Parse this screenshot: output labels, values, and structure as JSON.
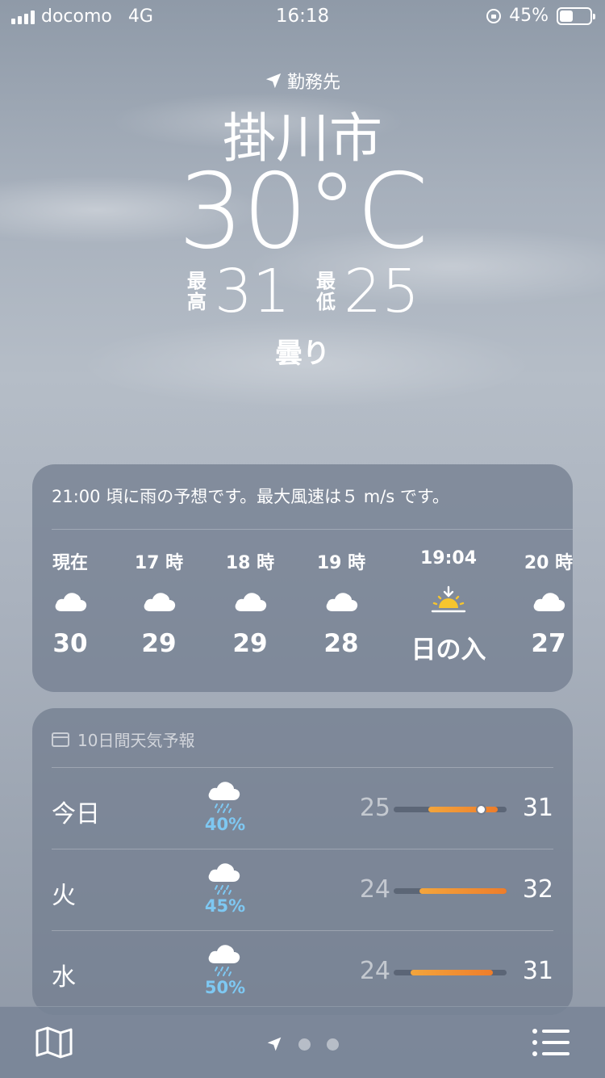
{
  "status_bar": {
    "carrier": "docomo",
    "network": "4G",
    "time": "16:18",
    "battery": "45%",
    "battery_level": 0.45
  },
  "header": {
    "location_label": "勤務先",
    "city": "掛川市",
    "temperature": "30°C",
    "high_label": "最高",
    "high": "31",
    "low_label": "最低",
    "low": "25",
    "condition": "曇り"
  },
  "hourly": {
    "summary": "21:00 頃に雨の予想です。最大風速は５ m/s です。",
    "items": [
      {
        "label": "現在",
        "icon": "cloud-icon",
        "value": "30"
      },
      {
        "label": "17 時",
        "icon": "cloud-icon",
        "value": "29"
      },
      {
        "label": "18 時",
        "icon": "cloud-icon",
        "value": "29"
      },
      {
        "label": "19 時",
        "icon": "cloud-icon",
        "value": "28"
      },
      {
        "label": "19:04",
        "icon": "sunset-icon",
        "value": "日の入"
      },
      {
        "label": "20 時",
        "icon": "cloud-icon",
        "value": "27"
      }
    ]
  },
  "daily": {
    "title": "10日間天気予報",
    "days": [
      {
        "day": "今日",
        "icon": "cloud-rain-icon",
        "pop": "40%",
        "low": "25",
        "high": "31",
        "range_start": 0.31,
        "range_end": 0.92,
        "current": 0.77
      },
      {
        "day": "火",
        "icon": "cloud-rain-icon",
        "pop": "45%",
        "low": "24",
        "high": "32",
        "range_start": 0.23,
        "range_end": 1.0
      },
      {
        "day": "水",
        "icon": "cloud-rain-icon",
        "pop": "50%",
        "low": "24",
        "high": "31",
        "range_start": 0.15,
        "range_end": 0.88
      }
    ]
  },
  "colors": {
    "accent_orange": "#ee7d2b",
    "precip_blue": "#7ec8f2"
  }
}
